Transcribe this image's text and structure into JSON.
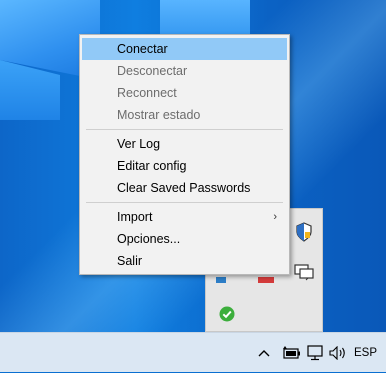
{
  "menu": {
    "items": [
      {
        "label": "Conectar",
        "state": "highlighted"
      },
      {
        "label": "Desconectar",
        "state": "disabled"
      },
      {
        "label": "Reconnect",
        "state": "disabled"
      },
      {
        "label": "Mostrar estado",
        "state": "disabled"
      },
      {
        "label": "Ver Log",
        "state": "enabled"
      },
      {
        "label": "Editar config",
        "state": "enabled"
      },
      {
        "label": "Clear Saved Passwords",
        "state": "enabled"
      },
      {
        "label": "Import",
        "state": "enabled",
        "submenu": true
      },
      {
        "label": "Opciones...",
        "state": "enabled"
      },
      {
        "label": "Salir",
        "state": "enabled"
      }
    ],
    "submenu_arrow": "›"
  },
  "tray": {
    "icons": [
      "shield-icon",
      "monitor-icon",
      "check-icon"
    ]
  },
  "taskbar": {
    "icons": [
      "chevron-up-icon",
      "battery-icon",
      "network-icon",
      "volume-icon"
    ],
    "language": "ESP"
  },
  "colors": {
    "highlight": "#91c9f7",
    "disabled_text": "#6d6d6d",
    "menu_bg": "#f2f2f2",
    "taskbar_bg": "#dbe7f3"
  }
}
